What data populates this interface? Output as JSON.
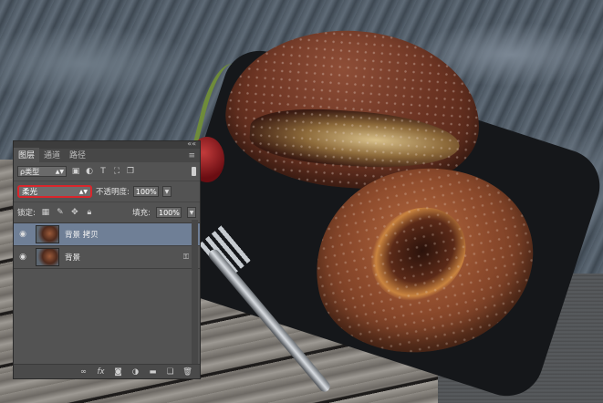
{
  "panel": {
    "tabs": [
      {
        "label": "图层",
        "active": true
      },
      {
        "label": "通道",
        "active": false
      },
      {
        "label": "路径",
        "active": false
      }
    ],
    "filter": {
      "kind_label": "ρ类型",
      "icons": [
        "image-filter-icon",
        "adjustment-filter-icon",
        "type-filter-icon",
        "shape-filter-icon",
        "smart-object-filter-icon"
      ]
    },
    "blend_mode": "柔光",
    "opacity_label": "不透明度:",
    "opacity_value": "100%",
    "lock_label": "锁定:",
    "fill_label": "填充:",
    "fill_value": "100%",
    "layers": [
      {
        "name": "背景 拷贝",
        "selected": true,
        "locked": false
      },
      {
        "name": "背景",
        "selected": false,
        "locked": true
      }
    ]
  },
  "colors": {
    "panel_bg": "#535353",
    "selected_layer": "#6f7f96",
    "blend_highlight": "#d9262c"
  }
}
